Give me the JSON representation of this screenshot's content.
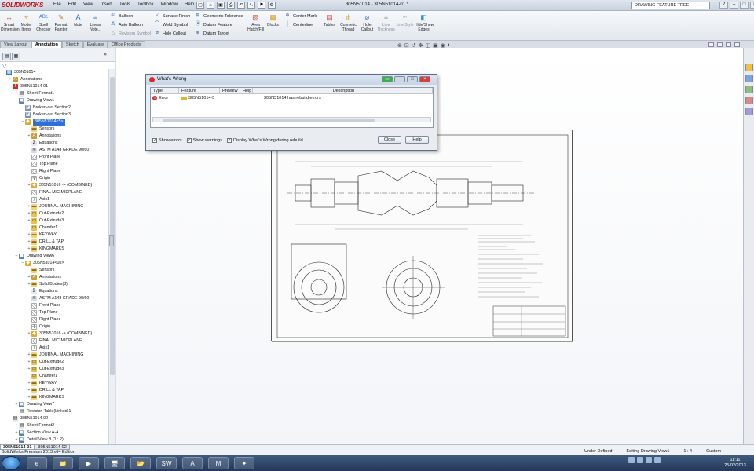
{
  "app": {
    "logo": "SOLIDWORKS",
    "menus": [
      "File",
      "Edit",
      "View",
      "Insert",
      "Tools",
      "Toolbox",
      "Window",
      "Help"
    ],
    "document_title": "305N51014 - 305N51014-01 *",
    "search_placeholder": "DRAWING FEATURE TREE",
    "window_controls": [
      "?",
      "–",
      "□",
      "×"
    ]
  },
  "toolbar": {
    "big_tools": [
      {
        "label": "Smart Dimension",
        "icon": "↔"
      },
      {
        "label": "Model Items",
        "icon": "⌖"
      },
      {
        "label": "Spell Checker",
        "icon": "ᴬᴮᶜ"
      },
      {
        "label": "Format Painter",
        "icon": "✎"
      },
      {
        "label": "Note",
        "icon": "A"
      },
      {
        "label": "Linear Note...",
        "icon": "≡"
      }
    ],
    "col1": [
      {
        "label": "Balloon",
        "icon": "①",
        "dim": false
      },
      {
        "label": "Auto Balloon",
        "icon": "⁂",
        "dim": false
      },
      {
        "label": "Revision Symbol",
        "icon": "△",
        "dim": true
      }
    ],
    "col2": [
      {
        "label": "Surface Finish",
        "icon": "√",
        "dim": false
      },
      {
        "label": "Weld Symbol",
        "icon": "⌒",
        "dim": false
      },
      {
        "label": "Hole Callout",
        "icon": "⌀",
        "dim": false
      }
    ],
    "col3": [
      {
        "label": "Geometric Tolerance",
        "icon": "⊞",
        "dim": false
      },
      {
        "label": "Datum Feature",
        "icon": "Ⓐ",
        "dim": false
      },
      {
        "label": "Datum Target",
        "icon": "⊗",
        "dim": false
      }
    ],
    "big_tools2": [
      {
        "label": "Area Hatch/Fill",
        "icon": "▨",
        "dim": false
      },
      {
        "label": "Blocks",
        "icon": "▦",
        "dim": false
      }
    ],
    "col4": [
      {
        "label": "Center Mark",
        "icon": "⊕",
        "dim": false
      },
      {
        "label": "Centerline",
        "icon": "┼",
        "dim": false
      }
    ],
    "big_tools3": [
      {
        "label": "Tables",
        "icon": "▤",
        "dim": false
      },
      {
        "label": "Cosmetic Thread",
        "icon": "⋔",
        "dim": false
      },
      {
        "label": "Hole Callout",
        "icon": "⌀",
        "dim": false
      },
      {
        "label": "Line Thickness",
        "icon": "≡",
        "dim": true
      },
      {
        "label": "Line Style",
        "icon": "┄",
        "dim": true
      },
      {
        "label": "Hide/Show Edges",
        "icon": "◧",
        "dim": false
      }
    ]
  },
  "tabs": [
    "View Layout",
    "Annotation",
    "Sketch",
    "Evaluate",
    "Office Products"
  ],
  "active_tab": "Annotation",
  "tree": [
    {
      "label": "305N51014",
      "d": 0,
      "ic": "doc",
      "exp": ""
    },
    {
      "label": "Annotations",
      "d": 1,
      "ic": "ann",
      "exp": "+"
    },
    {
      "label": "305N51014-01",
      "d": 1,
      "ic": "err",
      "exp": "–"
    },
    {
      "label": "Sheet Format1",
      "d": 2,
      "ic": "sheet",
      "exp": "+"
    },
    {
      "label": "Drawing View1",
      "d": 2,
      "ic": "view",
      "exp": "–"
    },
    {
      "label": "Broken-out Section2",
      "d": 3,
      "ic": "sec",
      "exp": ""
    },
    {
      "label": "Broken-out Section3",
      "d": 3,
      "ic": "sec",
      "exp": ""
    },
    {
      "label": "305N51014<5>",
      "d": 3,
      "ic": "part",
      "exp": "–",
      "sel": true
    },
    {
      "label": "Sensors",
      "d": 4,
      "ic": "fold",
      "exp": ""
    },
    {
      "label": "Annotations",
      "d": 4,
      "ic": "ann",
      "exp": "+"
    },
    {
      "label": "Equations",
      "d": 4,
      "ic": "eq",
      "exp": ""
    },
    {
      "label": "ASTM A148 GRADE 90/60",
      "d": 4,
      "ic": "mat",
      "exp": ""
    },
    {
      "label": "Front Plane",
      "d": 4,
      "ic": "plane",
      "exp": ""
    },
    {
      "label": "Top Plane",
      "d": 4,
      "ic": "plane",
      "exp": ""
    },
    {
      "label": "Right Plane",
      "d": 4,
      "ic": "plane",
      "exp": ""
    },
    {
      "label": "Origin",
      "d": 4,
      "ic": "orig",
      "exp": ""
    },
    {
      "label": "305N51016 -> (COMBINED)",
      "d": 4,
      "ic": "part",
      "exp": "+"
    },
    {
      "label": "FINAL M/C MIDPLANE",
      "d": 4,
      "ic": "plane",
      "exp": ""
    },
    {
      "label": "Axis1",
      "d": 4,
      "ic": "axis",
      "exp": ""
    },
    {
      "label": "JOURNAL MACHINING",
      "d": 4,
      "ic": "fold",
      "exp": "+"
    },
    {
      "label": "Cut-Extrude2",
      "d": 4,
      "ic": "cut",
      "exp": "+"
    },
    {
      "label": "Cut-Extrude3",
      "d": 4,
      "ic": "cut",
      "exp": "+"
    },
    {
      "label": "Chamfer1",
      "d": 4,
      "ic": "cut",
      "exp": ""
    },
    {
      "label": "KEYWAY",
      "d": 4,
      "ic": "fold",
      "exp": "+"
    },
    {
      "label": "DRILL & TAP",
      "d": 4,
      "ic": "fold",
      "exp": "+"
    },
    {
      "label": "KINGMARKS",
      "d": 4,
      "ic": "fold",
      "exp": "+"
    },
    {
      "label": "Drawing View6",
      "d": 2,
      "ic": "view",
      "exp": "–"
    },
    {
      "label": "305N51014<10>",
      "d": 3,
      "ic": "part",
      "exp": "–"
    },
    {
      "label": "Sensors",
      "d": 4,
      "ic": "fold",
      "exp": ""
    },
    {
      "label": "Annotations",
      "d": 4,
      "ic": "ann",
      "exp": "+"
    },
    {
      "label": "Solid Bodies(3)",
      "d": 4,
      "ic": "fold",
      "exp": "+"
    },
    {
      "label": "Equations",
      "d": 4,
      "ic": "eq",
      "exp": ""
    },
    {
      "label": "ASTM A148 GRADE 90/60",
      "d": 4,
      "ic": "mat",
      "exp": ""
    },
    {
      "label": "Front Plane",
      "d": 4,
      "ic": "plane",
      "exp": ""
    },
    {
      "label": "Top Plane",
      "d": 4,
      "ic": "plane",
      "exp": ""
    },
    {
      "label": "Right Plane",
      "d": 4,
      "ic": "plane",
      "exp": ""
    },
    {
      "label": "Origin",
      "d": 4,
      "ic": "orig",
      "exp": ""
    },
    {
      "label": "305N51016 -> (COMBINED)",
      "d": 4,
      "ic": "part",
      "exp": "+"
    },
    {
      "label": "FINAL M/C MIDPLANE",
      "d": 4,
      "ic": "plane",
      "exp": ""
    },
    {
      "label": "Axis1",
      "d": 4,
      "ic": "axis",
      "exp": ""
    },
    {
      "label": "JOURNAL MACHINING",
      "d": 4,
      "ic": "fold",
      "exp": "+"
    },
    {
      "label": "Cut-Extrude2",
      "d": 4,
      "ic": "cut",
      "exp": "+"
    },
    {
      "label": "Cut-Extrude3",
      "d": 4,
      "ic": "cut",
      "exp": "+"
    },
    {
      "label": "Chamfer1",
      "d": 4,
      "ic": "cut",
      "exp": ""
    },
    {
      "label": "KEYWAY",
      "d": 4,
      "ic": "fold",
      "exp": "+"
    },
    {
      "label": "DRILL & TAP",
      "d": 4,
      "ic": "fold",
      "exp": "+"
    },
    {
      "label": "KINGMARKS",
      "d": 4,
      "ic": "fold",
      "exp": "+"
    },
    {
      "label": "Drawing View7",
      "d": 2,
      "ic": "view",
      "exp": "+"
    },
    {
      "label": "Revision Table(Linked)1",
      "d": 2,
      "ic": "table",
      "exp": ""
    },
    {
      "label": "305N51014-02",
      "d": 1,
      "ic": "sheet",
      "exp": "–"
    },
    {
      "label": "Sheet Format2",
      "d": 2,
      "ic": "sheet",
      "exp": "+"
    },
    {
      "label": "Section View A-A",
      "d": 2,
      "ic": "view",
      "exp": "+"
    },
    {
      "label": "Detail View B (1 : 2)",
      "d": 2,
      "ic": "view",
      "exp": "+"
    }
  ],
  "dialog": {
    "title": "What's Wrong",
    "columns": [
      "Type",
      "Feature",
      "Preview",
      "Help",
      "Description"
    ],
    "row": {
      "type": "Error",
      "feature": "305N51014-5",
      "preview": "",
      "help": "",
      "description": "305N51014 has rebuild errors"
    },
    "options": [
      "Show errors",
      "Show warnings",
      "Display What's Wrong during rebuild"
    ],
    "buttons": [
      "Close",
      "Help"
    ]
  },
  "doc_tabs": [
    "305N51014-01",
    "305N51014-02"
  ],
  "status": {
    "left": "SolidWorks Premium 2013 x64 Edition",
    "state": "Under Defined",
    "mode": "Editing Drawing View1",
    "scale": "1 : 4",
    "units": "Custom"
  },
  "taskbar": {
    "apps": [
      "e",
      "📁",
      "▶",
      "🖥",
      "📂",
      "SW",
      "A",
      "M",
      "✦"
    ],
    "time": "11:11",
    "date": "25/02/2013"
  },
  "colors": {
    "accent": "#2f6fd6",
    "error": "#d72a2a",
    "brand": "#c0121b"
  }
}
